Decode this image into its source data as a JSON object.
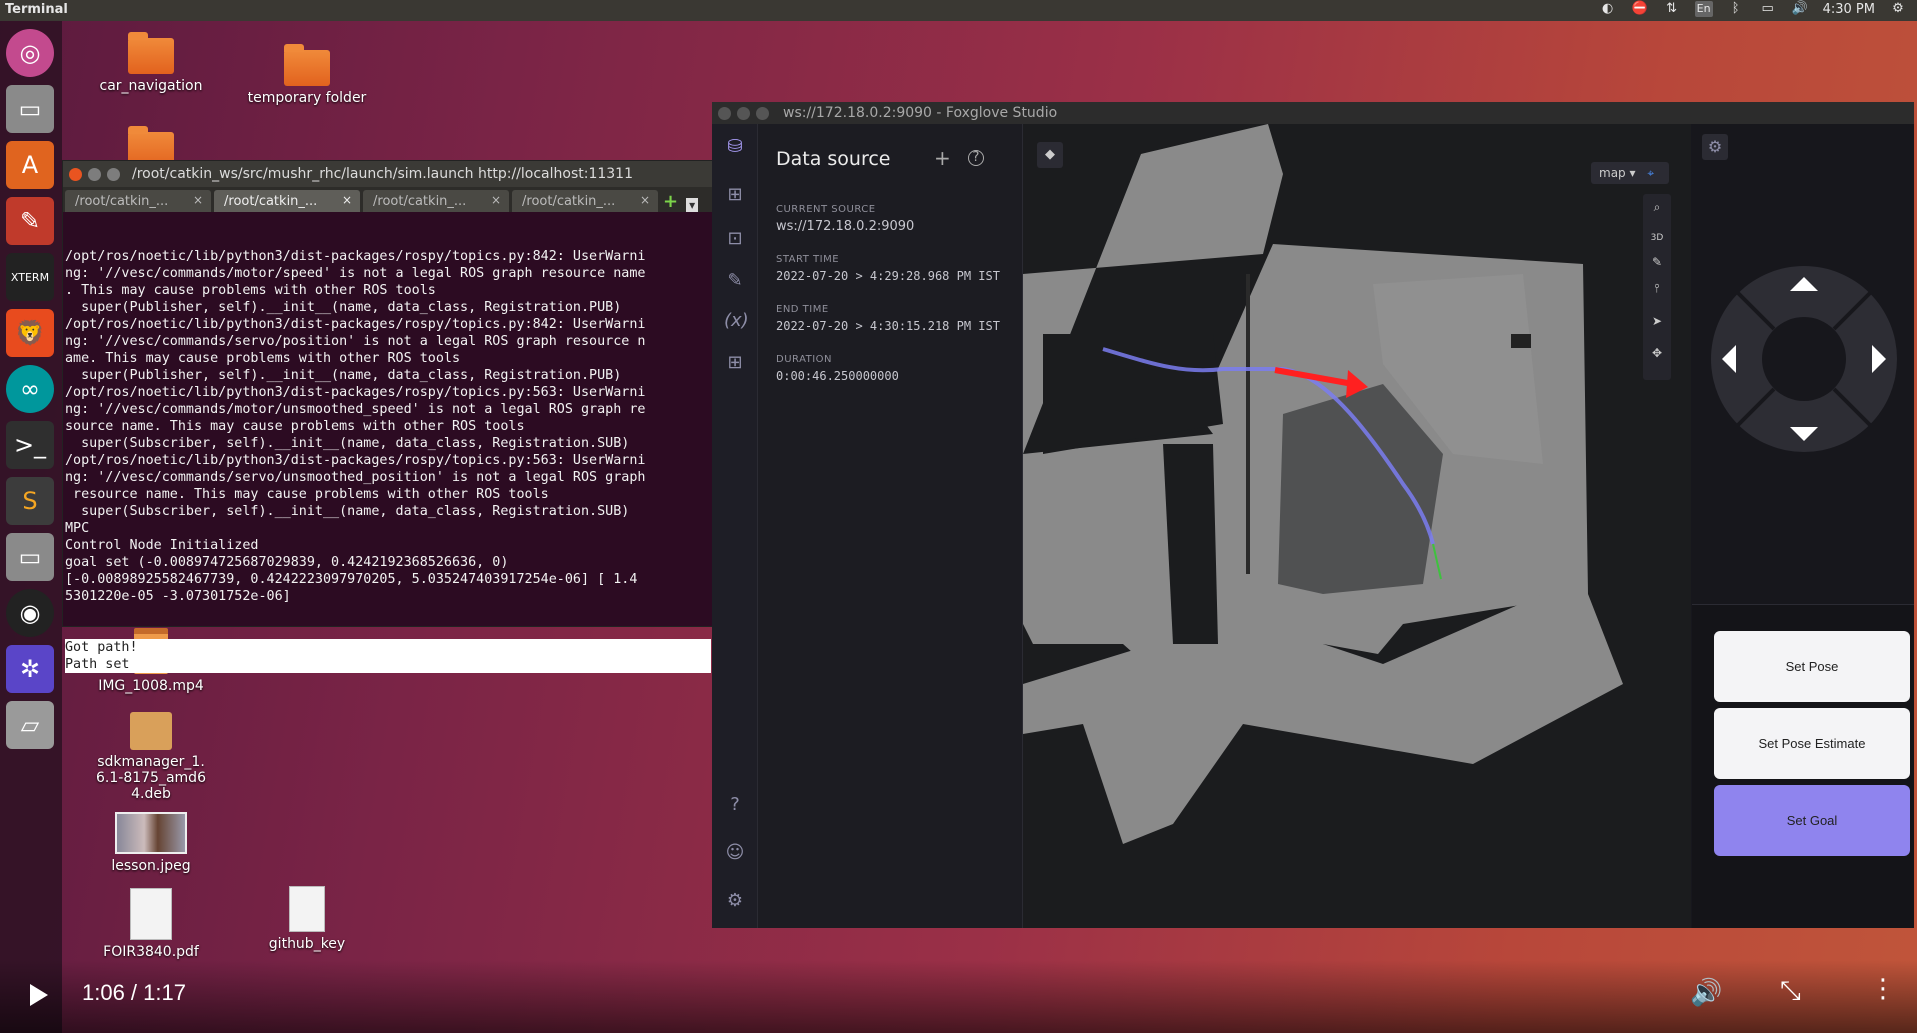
{
  "topbar": {
    "app_title": "Terminal",
    "lang": "En",
    "clock": "4:30 PM"
  },
  "desktop_icons": {
    "car_navigation": "car_navigation",
    "temporary_folder": "temporary folder",
    "img_video": "IMG_1008.mp4",
    "sdkmanager": "sdkmanager_1.6.1-8175_amd64.deb",
    "lesson": "lesson.jpeg",
    "foir_pdf": "FOIR3840.pdf",
    "github_key": "github_key"
  },
  "terminal": {
    "title": "/root/catkin_ws/src/mushr_rhc/launch/sim.launch http://localhost:11311",
    "tabs": [
      "/root/catkin_...",
      "/root/catkin_...",
      "/root/catkin_...",
      "/root/catkin_..."
    ],
    "lines": [
      "/opt/ros/noetic/lib/python3/dist-packages/rospy/topics.py:842: UserWarni",
      "ng: '//vesc/commands/motor/speed' is not a legal ROS graph resource name",
      ". This may cause problems with other ROS tools",
      "  super(Publisher, self).__init__(name, data_class, Registration.PUB)",
      "/opt/ros/noetic/lib/python3/dist-packages/rospy/topics.py:842: UserWarni",
      "ng: '//vesc/commands/servo/position' is not a legal ROS graph resource n",
      "ame. This may cause problems with other ROS tools",
      "  super(Publisher, self).__init__(name, data_class, Registration.PUB)",
      "/opt/ros/noetic/lib/python3/dist-packages/rospy/topics.py:563: UserWarni",
      "ng: '//vesc/commands/motor/unsmoothed_speed' is not a legal ROS graph re",
      "source name. This may cause problems with other ROS tools",
      "  super(Subscriber, self).__init__(name, data_class, Registration.SUB)",
      "/opt/ros/noetic/lib/python3/dist-packages/rospy/topics.py:563: UserWarni",
      "ng: '//vesc/commands/servo/unsmoothed_position' is not a legal ROS graph",
      " resource name. This may cause problems with other ROS tools",
      "  super(Subscriber, self).__init__(name, data_class, Registration.SUB)",
      "MPC",
      "Control Node Initialized",
      "goal set (-0.008974725687029839, 0.4242192368526636, 0)",
      "[-0.00898925582467739, 0.4242223097970205, 5.035247403917254e-06] [ 1.4",
      "5301220e-05 -3.07301752e-06]"
    ],
    "selected_lines": [
      "Got path!",
      "Path set"
    ]
  },
  "foxglove": {
    "window_title": "ws://172.18.0.2:9090 - Foxglove Studio",
    "panel_title": "Data source",
    "current_source_label": "CURRENT SOURCE",
    "current_source": "ws://172.18.0.2:9090",
    "start_time_label": "START TIME",
    "start_time": "2022-07-20 > 4:29:28.968 PM IST",
    "end_time_label": "END TIME",
    "end_time": "2022-07-20 > 4:30:15.218 PM IST",
    "duration_label": "DURATION",
    "duration": "0:00:46.250000000",
    "map_frame": "map",
    "view_mode": "3D",
    "buttons": {
      "set_pose": "Set Pose",
      "set_pose_estimate": "Set Pose Estimate",
      "set_goal": "Set Goal"
    }
  },
  "video": {
    "time": "1:06 / 1:17"
  },
  "colors": {
    "goal_arrow": "#ff2020",
    "path": "#7a7cf0",
    "set_goal_bg": "#8f84ee"
  }
}
